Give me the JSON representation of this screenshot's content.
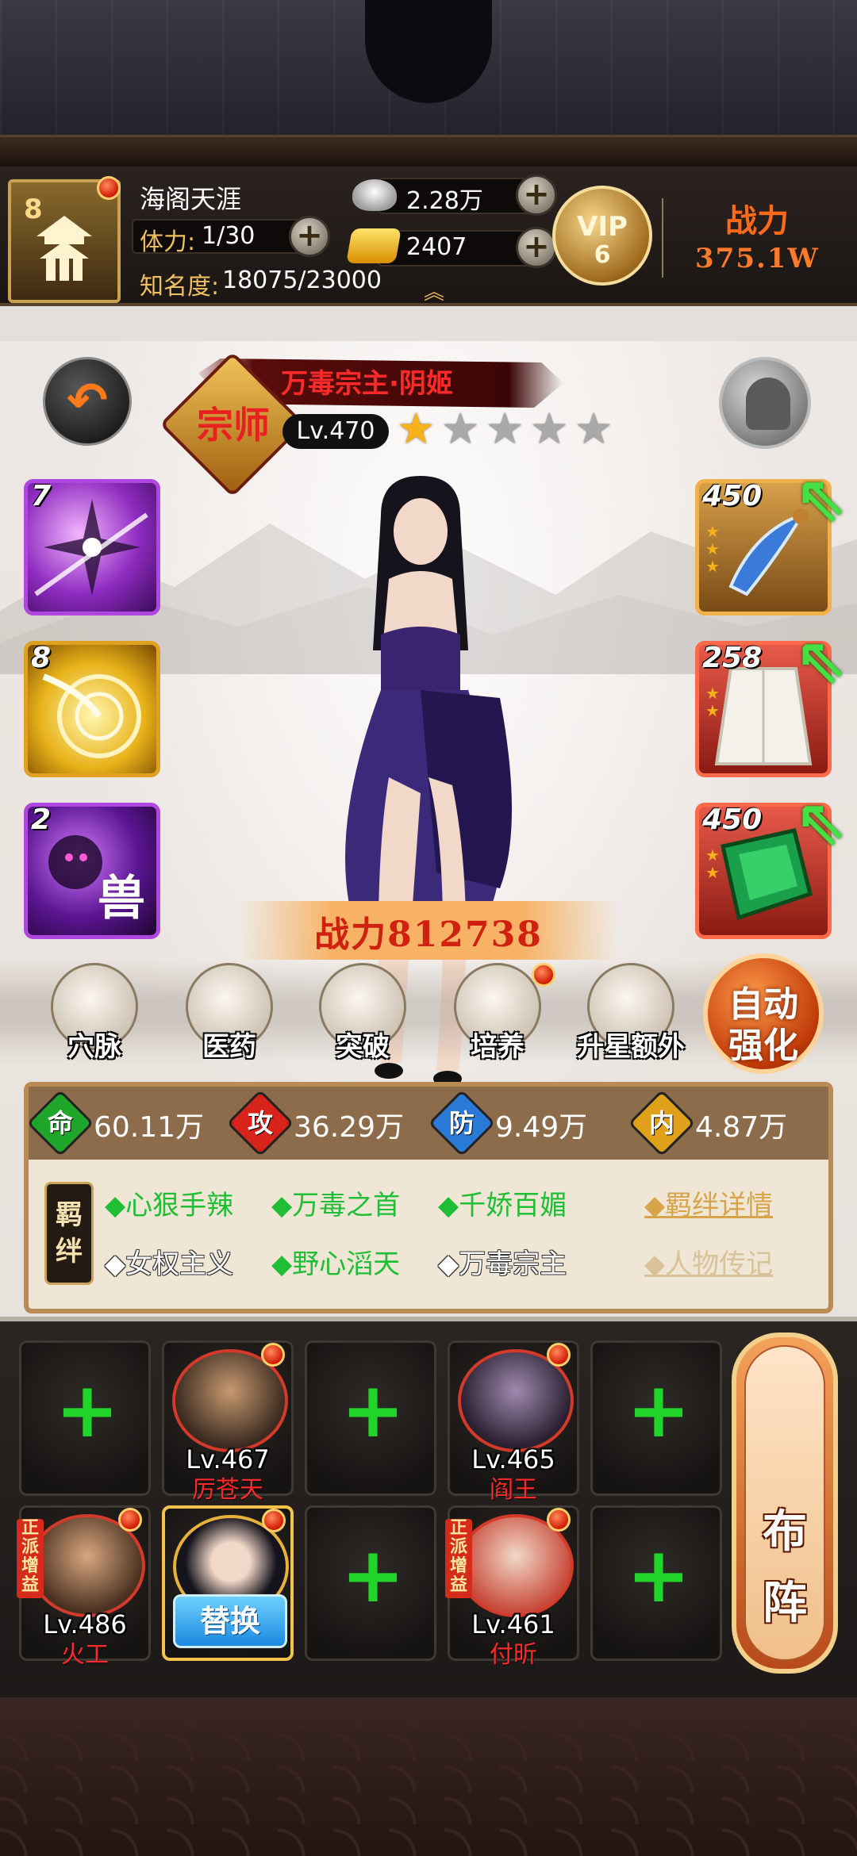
{
  "player": {
    "level": "8",
    "name": "海阁天涯",
    "stamina_label": "体力:",
    "stamina_value": "1/30",
    "fame_label": "知名度:",
    "fame_value": "18075/23000",
    "silver": "2.28万",
    "gold": "2407",
    "vip_text": "VIP",
    "vip_level": "6",
    "power_label": "战力",
    "power_value": "375.1W"
  },
  "hero": {
    "sect_badge": "宗师",
    "name": "万毒宗主·阴姬",
    "level": "Lv.470",
    "stars_total": 5,
    "stars_filled": 1,
    "power": "战力812738"
  },
  "skills": [
    {
      "level": "7",
      "icon": "shuriken-skill-icon",
      "glyph": ""
    },
    {
      "level": "8",
      "icon": "golden-vortex-skill-icon",
      "glyph": ""
    },
    {
      "level": "2",
      "icon": "beast-skill-icon",
      "glyph": "兽"
    }
  ],
  "equipment": [
    {
      "level": "450",
      "icon": "blue-blade-icon",
      "stars": 3,
      "upgradable": true
    },
    {
      "level": "258",
      "icon": "white-robe-icon",
      "stars": 2,
      "upgradable": true
    },
    {
      "level": "450",
      "icon": "green-manual-icon",
      "stars": 2,
      "upgradable": true
    }
  ],
  "functions": [
    {
      "label": "穴脉",
      "icon": "meridian-icon",
      "badge": false
    },
    {
      "label": "医药",
      "icon": "herb-icon",
      "badge": false
    },
    {
      "label": "突破",
      "icon": "breakthrough-icon",
      "badge": false
    },
    {
      "label": "培养",
      "icon": "scroll-icon",
      "badge": true
    },
    {
      "label": "升星额外",
      "icon": "star-chest-icon",
      "badge": false
    }
  ],
  "auto_enhance": {
    "line1": "自动",
    "line2": "强化"
  },
  "stats": [
    {
      "char": "命",
      "value": "60.11万",
      "color": "#1fa52a"
    },
    {
      "char": "攻",
      "value": "36.29万",
      "color": "#d8231a"
    },
    {
      "char": "防",
      "value": "9.49万",
      "color": "#2a7ad8"
    },
    {
      "char": "内",
      "value": "4.87万",
      "color": "#e0a01a"
    }
  ],
  "bonds": {
    "tag": "羁绊",
    "row1": [
      {
        "text": "◆心狠手辣",
        "active": true
      },
      {
        "text": "◆万毒之首",
        "active": true
      },
      {
        "text": "◆千娇百媚",
        "active": true
      }
    ],
    "row2": [
      {
        "text": "◆女权主义",
        "active": false
      },
      {
        "text": "◆野心滔天",
        "active": true
      },
      {
        "text": "◆万毒宗主",
        "active": false
      }
    ],
    "link1": "◆羁绊详情",
    "link2": "◆人物传记"
  },
  "team": {
    "row1": [
      {
        "type": "empty"
      },
      {
        "type": "hero",
        "level": "Lv.467",
        "name": "厉苍天",
        "badge": true,
        "tag": ""
      },
      {
        "type": "empty"
      },
      {
        "type": "hero",
        "level": "Lv.465",
        "name": "阎王",
        "badge": true,
        "tag": ""
      },
      {
        "type": "empty"
      }
    ],
    "row2": [
      {
        "type": "hero",
        "level": "Lv.486",
        "name": "火工",
        "badge": true,
        "tag": "正派增益"
      },
      {
        "type": "current",
        "swap_label": "替换",
        "badge": true
      },
      {
        "type": "empty"
      },
      {
        "type": "hero",
        "level": "Lv.461",
        "name": "付昕",
        "badge": true,
        "tag": "正派增益"
      },
      {
        "type": "empty"
      }
    ],
    "formation_line1": "布",
    "formation_line2": "阵"
  },
  "colors": {
    "accent_gold": "#c9a150",
    "danger_red": "#ff2a2a",
    "bond_green": "#1fbe34",
    "plus_green": "#22d32a"
  }
}
